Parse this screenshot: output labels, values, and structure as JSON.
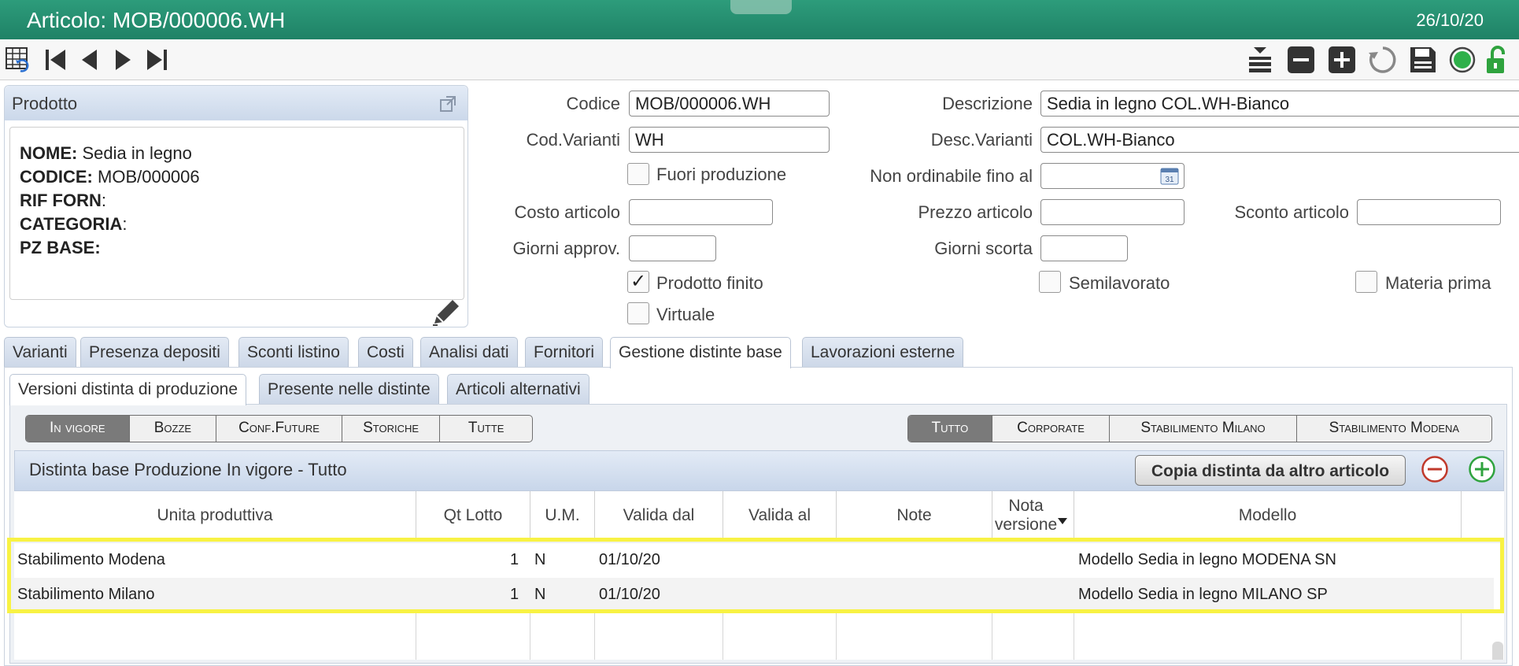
{
  "window": {
    "title": "Articolo: MOB/000006.WH",
    "date": "26/10/20"
  },
  "toolbar": {
    "left_icons": [
      "table-undo-icon",
      "first-record-icon",
      "prev-record-icon",
      "next-record-icon",
      "last-record-icon"
    ],
    "right_icons": [
      "stack-insert-icon",
      "minus-icon",
      "plus-icon",
      "refresh-icon",
      "save-icon",
      "status-dot-icon",
      "unlock-icon"
    ],
    "accent_green": "#2d9c7b"
  },
  "product": {
    "header": "Prodotto",
    "lines": [
      {
        "label": "NOME:",
        "value": " Sedia in legno"
      },
      {
        "label": "CODICE:",
        "value": " MOB/000006"
      },
      {
        "label": "RIF FORN",
        "value": ":"
      },
      {
        "label": "CATEGORIA",
        "value": ":"
      },
      {
        "label": "PZ BASE:",
        "value": ""
      }
    ]
  },
  "form": {
    "codice_label": "Codice",
    "codice": "MOB/000006.WH",
    "descrizione_label": "Descrizione",
    "descrizione": "Sedia in legno COL.WH-Bianco",
    "codvar_label": "Cod.Varianti",
    "codvar": "WH",
    "descvar_label": "Desc.Varianti",
    "descvar": "COL.WH-Bianco",
    "fuori_label": "Fuori produzione",
    "nonord_label": "Non ordinabile fino al",
    "nonord": "",
    "costo_label": "Costo articolo",
    "costo": "",
    "prezzo_label": "Prezzo articolo",
    "prezzo": "",
    "sconto_label": "Sconto articolo",
    "sconto": "",
    "giorni_approv_label": "Giorni approv.",
    "giorni_approv": "",
    "giorni_scorta_label": "Giorni scorta",
    "giorni_scorta": "",
    "prodotto_finito_label": "Prodotto finito",
    "prodotto_finito_check": "✓",
    "semilavorato_label": "Semilavorato",
    "materia_prima_label": "Materia prima",
    "virtuale_label": "Virtuale"
  },
  "tabs": [
    "Varianti",
    "Presenza depositi",
    "Sconti listino",
    "Costi",
    "Analisi dati",
    "Fornitori",
    "Gestione distinte base",
    "Lavorazioni esterne"
  ],
  "subtabs": [
    "Versioni distinta di produzione",
    "Presente nelle distinte",
    "Articoli alternativi"
  ],
  "filter_state": [
    "In vigore",
    "Bozze",
    "Conf.Future",
    "Storiche",
    "Tutte"
  ],
  "filter_site": [
    "Tutto",
    "Corporate",
    "Stabilimento Milano",
    "Stabilimento Modena"
  ],
  "grid": {
    "title": "Distinta base Produzione In vigore - Tutto",
    "copy_button": "Copia distinta da altro articolo",
    "columns": [
      "Unita produttiva",
      "Qt Lotto",
      "U.M.",
      "Valida dal",
      "Valida al",
      "Note",
      "Nota versione",
      "Modello"
    ],
    "rows": [
      {
        "unita": "Stabilimento Modena",
        "qt": "1",
        "um": "N",
        "dal": "01/10/20",
        "al": "",
        "note": "",
        "nota_versione": "",
        "modello": "Modello Sedia in legno MODENA SN"
      },
      {
        "unita": "Stabilimento Milano",
        "qt": "1",
        "um": "N",
        "dal": "01/10/20",
        "al": "",
        "note": "",
        "nota_versione": "",
        "modello": "Modello Sedia in legno MILANO SP"
      }
    ],
    "highlight_color": "#f8f244"
  }
}
